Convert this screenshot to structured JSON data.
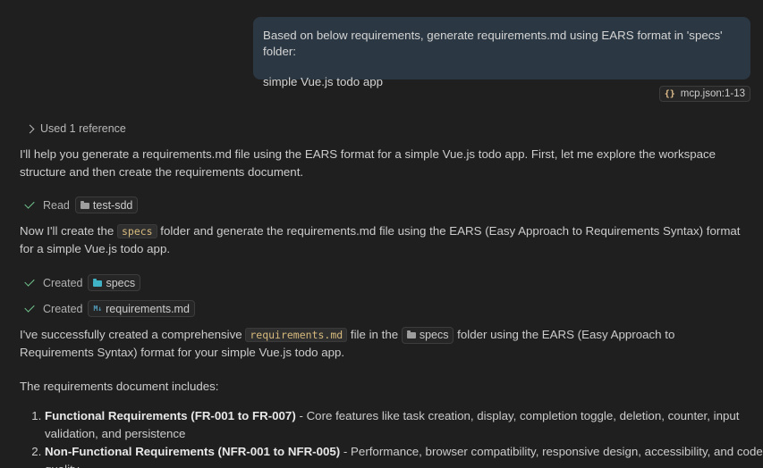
{
  "user_message": {
    "line1": "Based on below requirements, generate requirements.md using EARS format in 'specs' folder:",
    "line2": "simple Vue.js todo app"
  },
  "reference_chip": {
    "icon": "braces-icon",
    "label": "mcp.json:1-13"
  },
  "used_reference": "Used 1 reference",
  "intro": "I'll help you generate a requirements.md file using the EARS format for a simple Vue.js todo app. First, let me explore the workspace structure and then create the requirements document.",
  "read_action": {
    "verb": "Read",
    "target": "test-sdd"
  },
  "now_para": {
    "before": "Now I'll create the ",
    "code": "specs",
    "after": " folder and generate the requirements.md file using the EARS (Easy Approach to Requirements Syntax) format for a simple Vue.js todo app."
  },
  "created_actions": [
    {
      "verb": "Created",
      "target": "specs"
    },
    {
      "verb": "Created",
      "target": "requirements.md"
    }
  ],
  "success_para": {
    "p1": "I've successfully created a comprehensive ",
    "code": "requirements.md",
    "p2": " file in the ",
    "folder": "specs",
    "p3": " folder using the EARS (Easy Approach to Requirements Syntax) format for your simple Vue.js todo app."
  },
  "includes_heading": "The requirements document includes:",
  "list": [
    {
      "bold": "Functional Requirements (FR-001 to FR-007)",
      "text": " - Core features like task creation, display, completion toggle, deletion, counter, input validation, and persistence"
    },
    {
      "bold": "Non-Functional Requirements (NFR-001 to NFR-005)",
      "text": " - Performance, browser compatibility, responsive design, accessibility, and code quality"
    }
  ]
}
